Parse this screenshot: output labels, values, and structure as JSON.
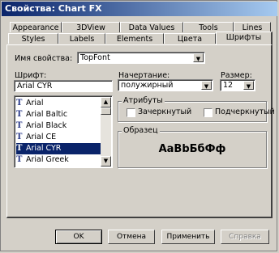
{
  "window": {
    "title": "Свойства: Chart FX"
  },
  "tabs_row1": [
    "Appearance",
    "3DView",
    "Data Values",
    "Tools",
    "Lines"
  ],
  "tabs_row2": [
    "Styles",
    "Labels",
    "Elements",
    "Цвета",
    "Шрифты"
  ],
  "active_tab": "Шрифты",
  "property_name": {
    "label": "Имя свойства:",
    "value": "TopFont"
  },
  "font": {
    "label": "Шрифт:",
    "value": "Arial CYR",
    "list": [
      "Arial",
      "Arial Baltic",
      "Arial Black",
      "Arial CE",
      "Arial CYR",
      "Arial Greek"
    ],
    "selected_index": 4
  },
  "style": {
    "label": "Начертание:",
    "value": "полужирный"
  },
  "size": {
    "label": "Размер:",
    "value": "12"
  },
  "attributes": {
    "label": "Атрибуты",
    "strikeout": "Зачеркнутый",
    "underline": "Подчеркнутый"
  },
  "sample": {
    "label": "Образец",
    "text": "AaBbБбФф"
  },
  "buttons": {
    "ok": "OK",
    "cancel": "Отмена",
    "apply": "Применить",
    "help": "Справка"
  },
  "colors": {
    "title_start": "#0a246a",
    "title_end": "#a6caf0",
    "selection": "#0a246a",
    "face": "#d4d0c8"
  }
}
